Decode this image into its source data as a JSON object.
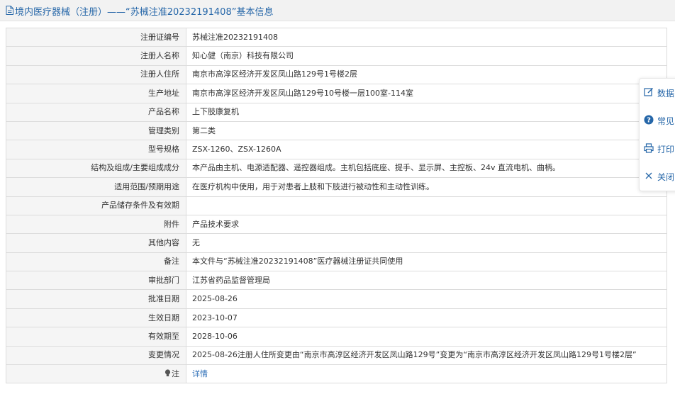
{
  "header": {
    "title": "境内医疗器械（注册）——“苏械注准20232191408”基本信息",
    "icon": "document-icon"
  },
  "rows": [
    {
      "label": "注册证编号",
      "value": "苏械注准20232191408"
    },
    {
      "label": "注册人名称",
      "value": "知心健（南京）科技有限公司"
    },
    {
      "label": "注册人住所",
      "value": "南京市高淳区经济开发区凤山路129号1号楼2层"
    },
    {
      "label": "生产地址",
      "value": "南京市高淳区经济开发区凤山路129号10号楼一层100室-114室"
    },
    {
      "label": "产品名称",
      "value": "上下肢康复机"
    },
    {
      "label": "管理类别",
      "value": "第二类"
    },
    {
      "label": "型号规格",
      "value": "ZSX-1260、ZSX-1260A"
    },
    {
      "label": "结构及组成/主要组成成分",
      "value": "本产品由主机、电源适配器、遥控器组成。主机包括底座、提手、显示屏、主控板、24v 直流电机、曲柄。"
    },
    {
      "label": "适用范围/预期用途",
      "value": "在医疗机构中使用，用于对患者上肢和下肢进行被动性和主动性训练。"
    },
    {
      "label": "产品储存条件及有效期",
      "value": ""
    },
    {
      "label": "附件",
      "value": "产品技术要求"
    },
    {
      "label": "其他内容",
      "value": "无"
    },
    {
      "label": "备注",
      "value": "本文件与“苏械注准20232191408”医疗器械注册证共同使用"
    },
    {
      "label": "审批部门",
      "value": "江苏省药品监督管理局"
    },
    {
      "label": "批准日期",
      "value": "2025-08-26"
    },
    {
      "label": "生效日期",
      "value": "2023-10-07"
    },
    {
      "label": "有效期至",
      "value": "2028-10-06"
    },
    {
      "label": "变更情况",
      "value": "2025-08-26注册人住所变更由“南京市高淳区经济开发区凤山路129号”变更为“南京市高淳区经济开发区凤山路129号1号楼2层”"
    }
  ],
  "note": {
    "label": "注",
    "icon": "lightbulb-icon",
    "link": "详情"
  },
  "side_panel": [
    {
      "label": "数据",
      "icon": "edit-icon"
    },
    {
      "label": "常见",
      "icon": "help-icon"
    },
    {
      "label": "打印",
      "icon": "print-icon"
    },
    {
      "label": "关闭",
      "icon": "close-icon"
    }
  ],
  "colors": {
    "accent": "#2566a8",
    "link": "#2e6fb7",
    "label_bg": "#f5f5f5",
    "border": "#dcdcdc",
    "header_bg": "#f2f2f2"
  }
}
